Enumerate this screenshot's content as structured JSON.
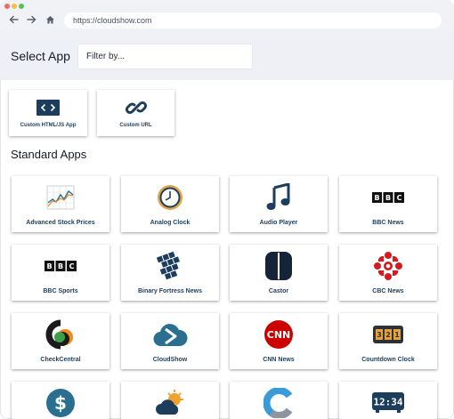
{
  "browser": {
    "url": "https://cloudshow.com"
  },
  "header": {
    "title": "Select App",
    "filter_placeholder": "Filter by..."
  },
  "custom_apps": [
    {
      "label": "Custom HTML/JS App",
      "icon": "code-icon"
    },
    {
      "label": "Custom URL",
      "icon": "link-icon"
    }
  ],
  "standard": {
    "title": "Standard Apps",
    "apps": [
      {
        "label": "Advanced Stock Prices",
        "icon": "stock-chart-icon"
      },
      {
        "label": "Analog Clock",
        "icon": "analog-clock-icon"
      },
      {
        "label": "Audio Player",
        "icon": "music-note-icon"
      },
      {
        "label": "BBC News",
        "icon": "bbc-logo-icon"
      },
      {
        "label": "BBC Sports",
        "icon": "bbc-logo-icon"
      },
      {
        "label": "Binary Fortress News",
        "icon": "binary-fortress-icon"
      },
      {
        "label": "Castor",
        "icon": "castor-icon"
      },
      {
        "label": "CBC News",
        "icon": "cbc-gem-icon"
      },
      {
        "label": "CheckCentral",
        "icon": "checkcentral-icon"
      },
      {
        "label": "CloudShow",
        "icon": "cloudshow-icon"
      },
      {
        "label": "CNN News",
        "icon": "cnn-logo-icon"
      },
      {
        "label": "Countdown Clock",
        "icon": "countdown-clock-icon"
      },
      {
        "label": "",
        "icon": "dollar-icon"
      },
      {
        "label": "",
        "icon": "weather-icon"
      },
      {
        "label": "",
        "icon": "letter-c-icon"
      },
      {
        "label": "",
        "icon": "digital-clock-icon"
      }
    ]
  },
  "colors": {
    "brand_navy": "#1c3e5c",
    "accent_teal": "#2a6f8f",
    "header_bg": "#eef0f5",
    "cnn_red": "#cc0000",
    "cbc_red": "#d71920"
  }
}
